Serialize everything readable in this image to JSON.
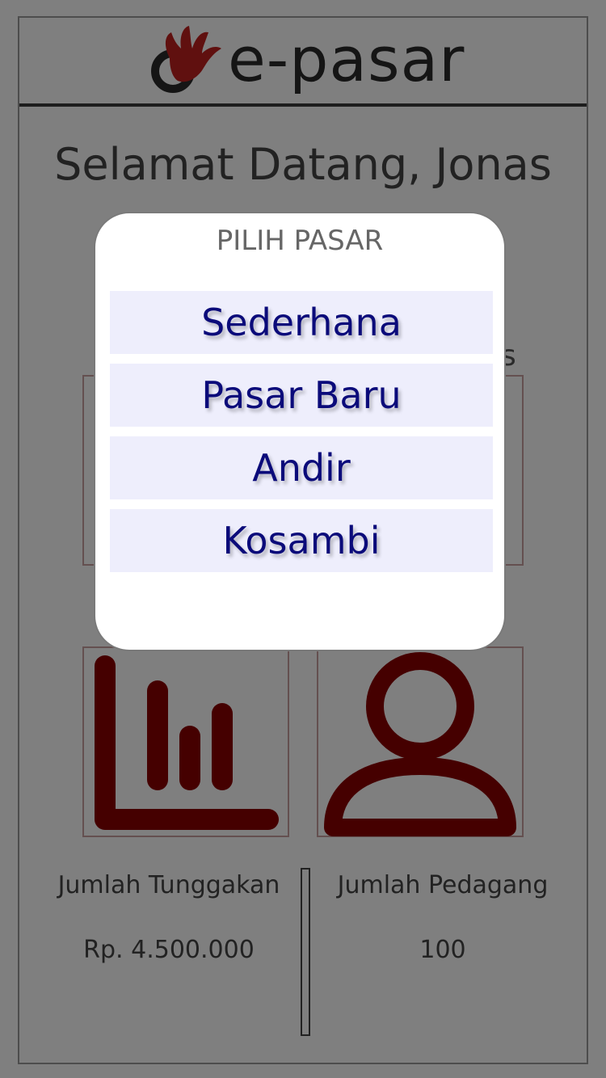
{
  "app": {
    "logo_text": "e-pasar",
    "brand_color": "#c0211f"
  },
  "welcome": "Selamat Datang, Jonas",
  "partial_text_behind_modal": "s",
  "tiles": {
    "chart_icon": "bar-chart-icon",
    "user_icon": "user-icon",
    "icon_color": "#8b0000"
  },
  "stats": {
    "left_label": "Jumlah Tunggakan",
    "left_value": "Rp. 4.500.000",
    "right_label": "Jumlah Pedagang",
    "right_value": "100"
  },
  "modal": {
    "title": "PILIH PASAR",
    "options": [
      "Sederhana",
      "Pasar Baru",
      "Andir",
      "Kosambi"
    ]
  }
}
